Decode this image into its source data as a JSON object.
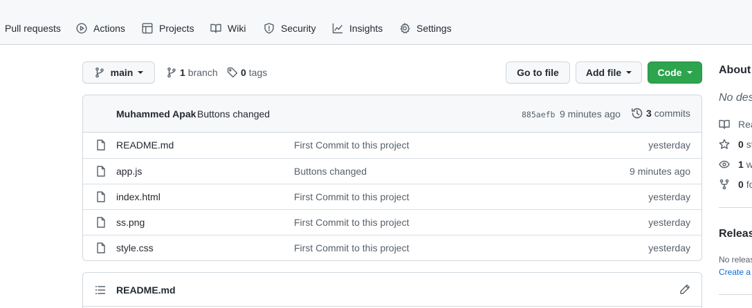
{
  "repo_nav": {
    "items": [
      {
        "label": "Pull requests",
        "icon": "pull-request-icon"
      },
      {
        "label": "Actions",
        "icon": "play-icon"
      },
      {
        "label": "Projects",
        "icon": "table-icon"
      },
      {
        "label": "Wiki",
        "icon": "book-icon"
      },
      {
        "label": "Security",
        "icon": "shield-icon"
      },
      {
        "label": "Insights",
        "icon": "graph-icon"
      },
      {
        "label": "Settings",
        "icon": "gear-icon"
      }
    ]
  },
  "branch_bar": {
    "branch_name": "main",
    "branch_count": "1",
    "branch_label": "branch",
    "tag_count": "0",
    "tag_label": "tags",
    "go_to_file_label": "Go to file",
    "add_file_label": "Add file",
    "code_label": "Code"
  },
  "latest_commit": {
    "author": "Muhammed Apak",
    "message": "Buttons changed",
    "sha": "885aefb",
    "time": "9 minutes ago",
    "commit_count": "3",
    "commit_label": "commits"
  },
  "files": [
    {
      "name": "README.md",
      "message": "First Commit to this project",
      "time": "yesterday"
    },
    {
      "name": "app.js",
      "message": "Buttons changed",
      "time": "9 minutes ago"
    },
    {
      "name": "index.html",
      "message": "First Commit to this project",
      "time": "yesterday"
    },
    {
      "name": "ss.png",
      "message": "First Commit to this project",
      "time": "yesterday"
    },
    {
      "name": "style.css",
      "message": "First Commit to this project",
      "time": "yesterday"
    }
  ],
  "readme": {
    "title": "README.md"
  },
  "sidebar": {
    "about_title": "About",
    "about_description": "No des",
    "readme_label": "Rea",
    "stars_count": "0",
    "stars_label": "st",
    "watchers_count": "1",
    "watchers_label": "w",
    "forks_count": "0",
    "forks_label": "fo",
    "releases_title": "Release",
    "releases_none": "No releas",
    "releases_create": "Create a r"
  },
  "colors": {
    "accent_green": "#2da44e",
    "link_blue": "#0969da",
    "muted": "#57606a",
    "border": "#d0d7de"
  }
}
